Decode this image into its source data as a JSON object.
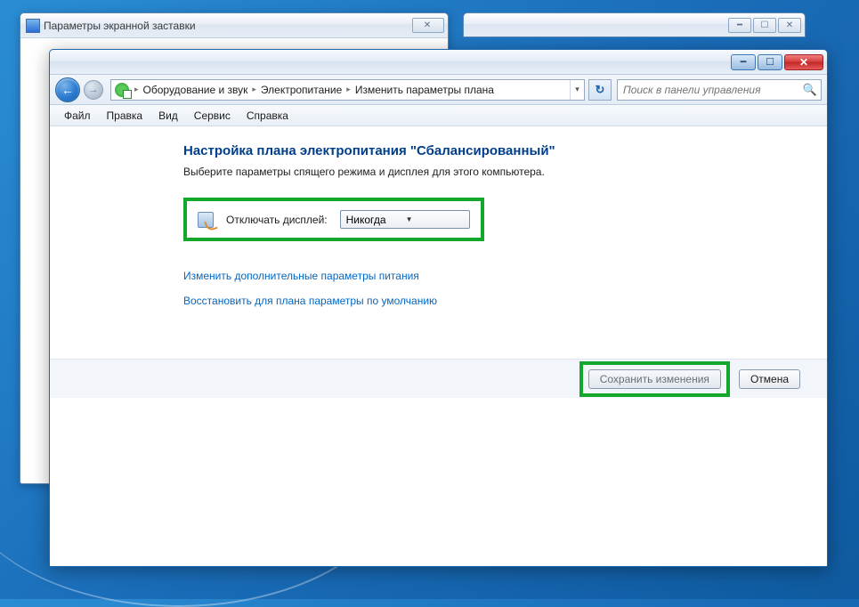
{
  "bg_window": {
    "title": "Параметры экранной заставки"
  },
  "breadcrumbs": {
    "item1": "Оборудование и звук",
    "item2": "Электропитание",
    "item3": "Изменить параметры плана"
  },
  "search": {
    "placeholder": "Поиск в панели управления"
  },
  "menu": {
    "file": "Файл",
    "edit": "Правка",
    "view": "Вид",
    "service": "Сервис",
    "help": "Справка"
  },
  "page": {
    "title": "Настройка плана электропитания \"Сбалансированный\"",
    "subtitle": "Выберите параметры спящего режима и дисплея для этого компьютера."
  },
  "setting": {
    "label": "Отключать дисплей:",
    "value": "Никогда"
  },
  "links": {
    "advanced": "Изменить дополнительные параметры питания",
    "restore": "Восстановить для плана параметры по умолчанию"
  },
  "buttons": {
    "save": "Сохранить изменения",
    "cancel": "Отмена"
  }
}
